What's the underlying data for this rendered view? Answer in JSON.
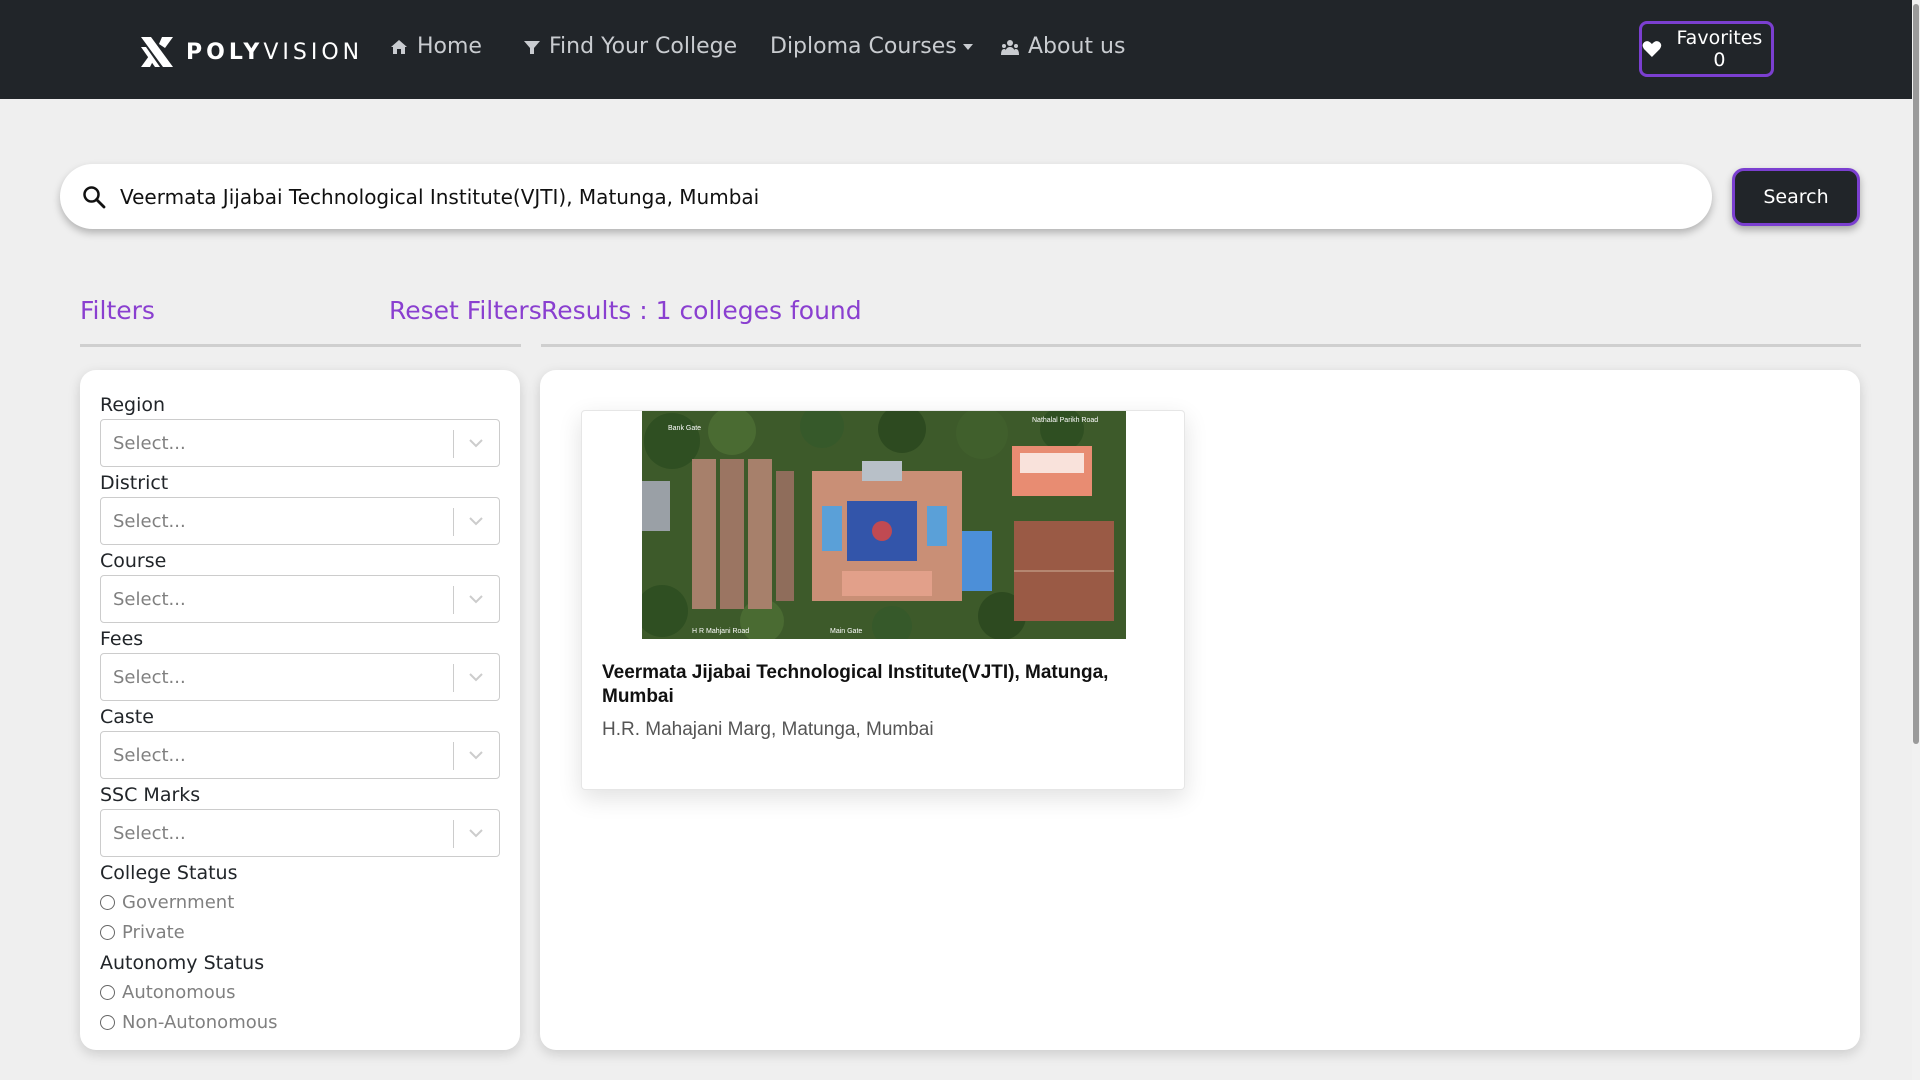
{
  "brand": {
    "poly": "POLY",
    "vision": "VISION",
    "logo_icon": "polyvision-logo-icon"
  },
  "nav": {
    "home": "Home",
    "find_college": "Find Your College",
    "diploma_courses": "Diploma Courses",
    "about": "About us"
  },
  "favorites": {
    "label": "Favorites 0",
    "icon": "heart-icon"
  },
  "search": {
    "value": "Veermata Jijabai Technological Institute(VJTI), Matunga, Mumbai",
    "button": "Search"
  },
  "filters": {
    "title": "Filters",
    "reset": "Reset Filters",
    "region": {
      "label": "Region",
      "placeholder": "Select..."
    },
    "district": {
      "label": "District",
      "placeholder": "Select..."
    },
    "course": {
      "label": "Course",
      "placeholder": "Select..."
    },
    "fees": {
      "label": "Fees",
      "placeholder": "Select..."
    },
    "caste": {
      "label": "Caste",
      "placeholder": "Select..."
    },
    "ssc_marks": {
      "label": "SSC Marks",
      "placeholder": "Select..."
    },
    "college_status": {
      "label": "College Status",
      "options": [
        "Government",
        "Private"
      ]
    },
    "autonomy_status": {
      "label": "Autonomy Status",
      "options": [
        "Autonomous",
        "Non-Autonomous"
      ]
    }
  },
  "results": {
    "header": "Results : 1 colleges found",
    "cards": [
      {
        "name": "Veermata Jijabai Technological Institute(VJTI), Matunga, Mumbai",
        "address": "H.R. Mahajani Marg, Matunga, Mumbai",
        "image_labels": {
          "bank_gate": "Bank Gate",
          "road_top": "Nathalal Parikh Road",
          "road_bottom": "H R Mahjani Road",
          "main_gate": "Main Gate"
        }
      }
    ]
  },
  "colors": {
    "navbar": "#212529",
    "accent": "#8a3fd0",
    "background": "#efefef"
  }
}
